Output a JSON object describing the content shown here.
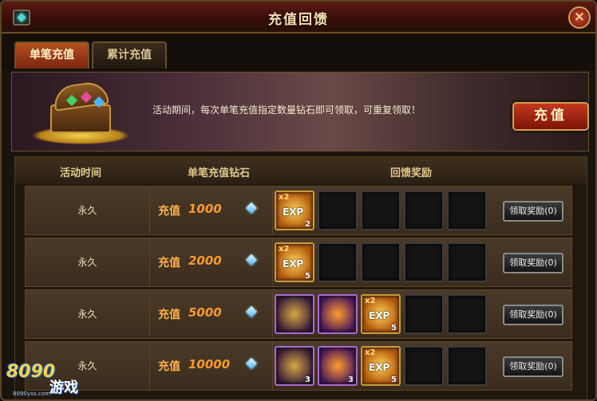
{
  "window": {
    "title": "充值回馈",
    "close_label": "✕"
  },
  "tabs": [
    {
      "label": "单笔充值",
      "active": true
    },
    {
      "label": "累计充值",
      "active": false
    }
  ],
  "banner": {
    "text": "活动期间，每次单笔充值指定数量钻石即可领取，可重复领取！",
    "button_label": "充值"
  },
  "table": {
    "headers": [
      "活动时间",
      "单笔充值钻石",
      "回馈奖励"
    ],
    "rows": [
      {
        "time": "永久",
        "amount_label": "充值",
        "amount": "1000",
        "rewards": [
          {
            "type": "exp",
            "badge": "x2",
            "label": "EXP",
            "count": "2"
          }
        ],
        "claim_label": "领取奖励(0)"
      },
      {
        "time": "永久",
        "amount_label": "充值",
        "amount": "2000",
        "rewards": [
          {
            "type": "exp",
            "badge": "x2",
            "label": "EXP",
            "count": "5"
          }
        ],
        "claim_label": "领取奖励(0)"
      },
      {
        "time": "永久",
        "amount_label": "充值",
        "amount": "5000",
        "rewards": [
          {
            "type": "horn",
            "count": ""
          },
          {
            "type": "gem",
            "count": ""
          },
          {
            "type": "exp",
            "badge": "x2",
            "label": "EXP",
            "count": "5"
          }
        ],
        "claim_label": "领取奖励(0)"
      },
      {
        "time": "永久",
        "amount_label": "充值",
        "amount": "10000",
        "rewards": [
          {
            "type": "horn",
            "count": "3"
          },
          {
            "type": "gem",
            "count": "3"
          },
          {
            "type": "exp",
            "badge": "x2",
            "label": "EXP",
            "count": "5"
          }
        ],
        "claim_label": "领取奖励(0)"
      }
    ]
  },
  "logo": {
    "main": "8090",
    "sub": "游戏",
    "url": "8090yxs.com"
  },
  "colors": {
    "accent": "#c3381e",
    "gold": "#ff9a2c",
    "border": "#6b5127"
  }
}
